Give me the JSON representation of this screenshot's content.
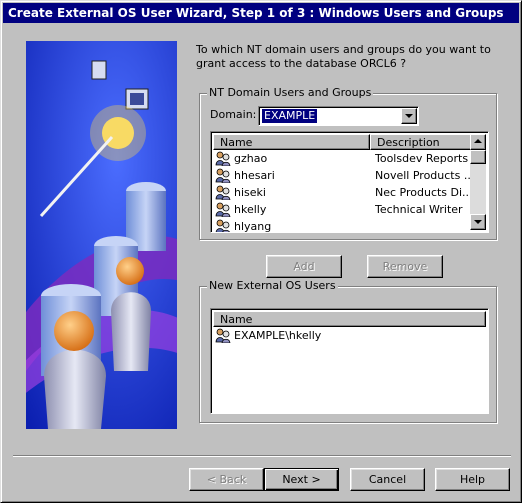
{
  "window": {
    "title": "Create External OS User Wizard, Step 1 of 3 : Windows Users and Groups"
  },
  "prompt": "To which NT domain users and groups do you want to grant access to the database ORCL6 ?",
  "nt_group": {
    "legend": "NT Domain Users and Groups",
    "domain_label": "Domain:",
    "domain_value": "EXAMPLE",
    "columns": [
      "Name",
      "Description"
    ],
    "rows": [
      {
        "name": "gzhao",
        "description": "Toolsdev Reports"
      },
      {
        "name": "hhesari",
        "description": "Novell Products ..."
      },
      {
        "name": "hiseki",
        "description": "Nec Products Di..."
      },
      {
        "name": "hkelly",
        "description": "Technical Writer"
      },
      {
        "name": "hlyang",
        "description": ""
      }
    ]
  },
  "buttons": {
    "add": "Add",
    "remove": "Remove",
    "back": "< Back",
    "next": "Next >",
    "cancel": "Cancel",
    "help": "Help"
  },
  "new_group": {
    "legend": "New External OS Users",
    "columns": [
      "Name"
    ],
    "rows": [
      {
        "name": "EXAMPLE\\hkelly"
      }
    ]
  },
  "icons": {
    "row_icon": "user-icon",
    "combo_arrow": "chevron-down-icon",
    "scroll_up": "arrow-up-icon",
    "scroll_down": "arrow-down-icon"
  },
  "colors": {
    "title_bar": "#000080",
    "face": "#c0c0c0",
    "selection": "#000080",
    "art_background": "#1232d8"
  }
}
